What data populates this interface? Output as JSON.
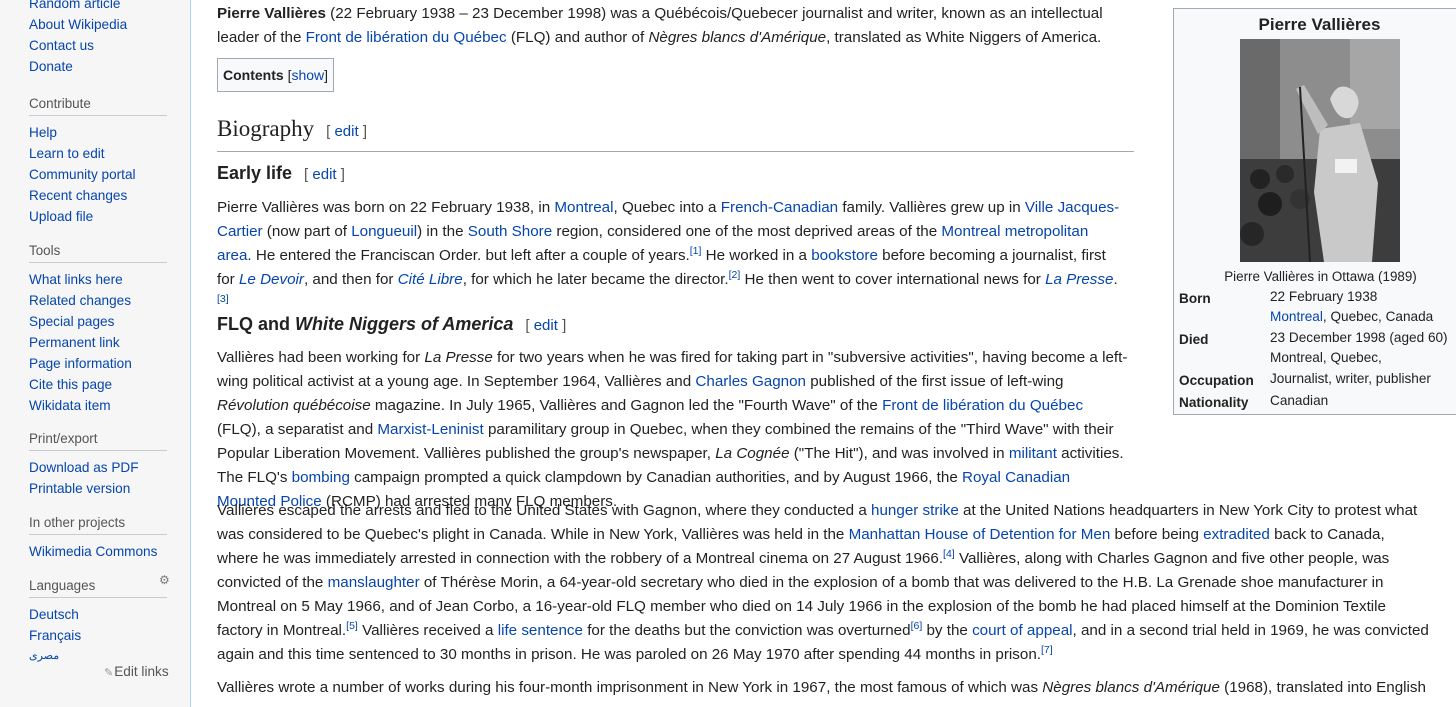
{
  "sidebar": {
    "top_items": [
      "Random article",
      "About Wikipedia",
      "Contact us",
      "Donate"
    ],
    "contribute": {
      "heading": "Contribute",
      "items": [
        "Help",
        "Learn to edit",
        "Community portal",
        "Recent changes",
        "Upload file"
      ]
    },
    "tools": {
      "heading": "Tools",
      "items": [
        "What links here",
        "Related changes",
        "Special pages",
        "Permanent link",
        "Page information",
        "Cite this page",
        "Wikidata item"
      ]
    },
    "print": {
      "heading": "Print/export",
      "items": [
        "Download as PDF",
        "Printable version"
      ]
    },
    "projects": {
      "heading": "In other projects",
      "items": [
        "Wikimedia Commons"
      ]
    },
    "languages": {
      "heading": "Languages",
      "items": [
        "Deutsch",
        "Français",
        "مصرى"
      ],
      "edit_links": "Edit links"
    }
  },
  "article": {
    "intro": {
      "subject": "Pierre Vallières",
      "t1": " (22 February 1938 – 23 December 1998) was a Québécois/Quebecer journalist and writer, known as an intellectual leader of the ",
      "flq_link": "Front de libération du Québec",
      "t2": " (FLQ) and author of ",
      "book": "Nègres blancs d'Amérique",
      "t3": ", translated as White Niggers of America."
    },
    "toc": {
      "title": "Contents",
      "open": "[",
      "toggle": "show",
      "close": "]"
    },
    "edit_label": "edit",
    "bracket_open": "[",
    "bracket_close": "]",
    "h_biography": "Biography",
    "h_early": "Early life",
    "h_flq_a": "FLQ and ",
    "h_flq_b": "White Niggers of America",
    "early": {
      "a": "Pierre Vallières was born on 22 February 1938, in ",
      "l_montreal": "Montreal",
      "b": ", Quebec into a ",
      "l_french": "French-Canadian",
      "c": " family. Vallières grew up in ",
      "l_ville": "Ville Jacques-Cartier",
      "d": " (now part of ",
      "l_longueuil": "Longueuil",
      "e": ") in the ",
      "l_southshore": "South Shore",
      "f": " region, considered one of the most deprived areas of the ",
      "l_metro": "Montreal metropolitan area",
      "g": ". He entered the Franciscan Order. but left after a couple of years.",
      "r1": "[1]",
      "h": " He worked in a ",
      "l_bookstore": "bookstore",
      "i": " before becoming a journalist, first for ",
      "l_devoir": "Le Devoir",
      "j": ", and then for ",
      "l_citelibre": "Cité Libre",
      "k": ", for which he later became the director.",
      "r2": "[2]",
      "l": " He then went to cover international news for ",
      "l_lapresse": "La Presse",
      "m": ".",
      "r3": "[3]"
    },
    "flq1": {
      "a": "Vallières had been working for ",
      "i_lapresse": "La Presse",
      "b": " for two years when he was fired for taking part in \"subversive activities\", having become a left-wing political activist at a young age. In September 1964, Vallières and ",
      "l_gagnon": "Charles Gagnon",
      "c": " published of the first issue of left-wing ",
      "i_revolution": "Révolution québécoise",
      "d": " magazine. In July 1965, Vallières and Gagnon led the \"Fourth Wave\" of the ",
      "l_flq": "Front de libération du Québec",
      "e": " (FLQ), a separatist and ",
      "l_marxist": "Marxist-Leninist",
      "f": " paramilitary group in Quebec, when they combined the remains of the \"Third Wave\" with their Popular Liberation Movement. Vallières published the group's newspaper, ",
      "i_cognee": "La Cognée",
      "g": " (\"The Hit\"), and was involved in ",
      "l_militant": "militant",
      "h": " activities. The FLQ's ",
      "l_bombing": "bombing",
      "i": " campaign prompted a quick clampdown by Canadian authorities, and by August 1966, the ",
      "l_rcmp": "Royal Canadian Mounted Police",
      "j": " (RCMP) had arrested many FLQ members."
    },
    "flq2": {
      "a": "Vallières escaped the arrests and fled to the United States with Gagnon, where they conducted a ",
      "l_hunger": "hunger strike",
      "b": " at the United Nations headquarters in New York City to protest what was considered to be Quebec's plight in Canada. While in New York, Vallières was held in the ",
      "l_manhattan": "Manhattan House of Detention for Men",
      "c": " before being ",
      "l_extradited": "extradited",
      "d": " back to Canada, where he was immediately arrested in connection with the robbery of a Montreal cinema on 27 August 1966.",
      "r4": "[4]",
      "e": " Vallières, along with Charles Gagnon and five other people, was convicted of the ",
      "l_manslaughter": "manslaughter",
      "f": " of Thérèse Morin, a 64-year-old secretary who died in the explosion of a bomb that was delivered to the H.B. La Grenade shoe manufacturer in Montreal on 5 May 1966, and of Jean Corbo, a 16-year-old FLQ member who died on 14 July 1966 in the explosion of the bomb he had placed himself at the Dominion Textile factory in Montreal.",
      "r5": "[5]",
      "g": " Vallières received a ",
      "l_life": "life sentence",
      "h": " for the deaths but the conviction was overturned",
      "r6": "[6]",
      "i": " by the ",
      "l_appeal": "court of appeal",
      "j": ", and in a second trial held in 1969, he was convicted again and this time sentenced to 30 months in prison. He was paroled on 26 May 1970 after spending 44 months in prison.",
      "r7": "[7]"
    },
    "flq3": {
      "a": "Vallières wrote a number of works during his four-month imprisonment in New York in 1967, the most famous of which was ",
      "i_book": "Nègres blancs d'Amérique",
      "b": " (1968), translated into English"
    }
  },
  "infobox": {
    "title": "Pierre Vallières",
    "caption": "Pierre Vallières in Ottawa (1989)",
    "born_label": "Born",
    "born_line1": "22 February 1938",
    "born_link": "Montreal",
    "born_rest": ", Quebec, Canada",
    "died_label": "Died",
    "died_line1": "23 December 1998 (aged 60)",
    "died_line2": "Montreal, Quebec,",
    "occupation_label": "Occupation",
    "occupation": "Journalist, writer, publisher",
    "nationality_label": "Nationality",
    "nationality": "Canadian"
  }
}
